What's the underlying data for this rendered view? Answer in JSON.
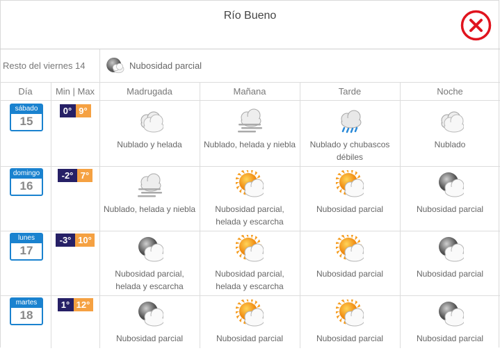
{
  "window": {
    "title": "Río Bueno",
    "close_icon": "close-circle-icon",
    "close_color": "#e0141e"
  },
  "rest_of_day": {
    "label": "Resto del viernes 14",
    "condition": "Nubosidad parcial",
    "icon": "partly-cloudy-night-icon"
  },
  "table": {
    "headers": {
      "day": "Día",
      "minmax": "Min | Max",
      "periods": [
        "Madrugada",
        "Mañana",
        "Tarde",
        "Noche"
      ]
    },
    "days": [
      {
        "weekday": "sábado",
        "date": "15",
        "min": "0°",
        "max": "9°",
        "periods": [
          {
            "icon": "cloudy-frost-icon",
            "text": "Nublado y helada"
          },
          {
            "icon": "cloudy-frost-fog-icon",
            "text": "Nublado, helada y niebla"
          },
          {
            "icon": "cloudy-showers-icon",
            "text": "Nublado y chubascos débiles"
          },
          {
            "icon": "cloudy-icon",
            "text": "Nublado"
          }
        ]
      },
      {
        "weekday": "domingo",
        "date": "16",
        "min": "-2°",
        "max": "7°",
        "periods": [
          {
            "icon": "cloudy-frost-fog-icon",
            "text": "Nublado, helada y niebla"
          },
          {
            "icon": "partly-cloudy-sun-icon",
            "text": "Nubosidad parcial, helada y escarcha"
          },
          {
            "icon": "partly-cloudy-sun-icon",
            "text": "Nubosidad parcial"
          },
          {
            "icon": "partly-cloudy-night-icon",
            "text": "Nubosidad parcial"
          }
        ]
      },
      {
        "weekday": "lunes",
        "date": "17",
        "min": "-3°",
        "max": "10°",
        "periods": [
          {
            "icon": "partly-cloudy-night-icon",
            "text": "Nubosidad parcial, helada y escarcha"
          },
          {
            "icon": "partly-cloudy-sun-icon",
            "text": "Nubosidad parcial, helada y escarcha"
          },
          {
            "icon": "partly-cloudy-sun-icon",
            "text": "Nubosidad parcial"
          },
          {
            "icon": "partly-cloudy-night-icon",
            "text": "Nubosidad parcial"
          }
        ]
      },
      {
        "weekday": "martes",
        "date": "18",
        "min": "1°",
        "max": "12°",
        "periods": [
          {
            "icon": "partly-cloudy-night-icon",
            "text": "Nubosidad parcial"
          },
          {
            "icon": "partly-cloudy-sun-icon",
            "text": "Nubosidad parcial"
          },
          {
            "icon": "partly-cloudy-sun-icon",
            "text": "Nubosidad parcial"
          },
          {
            "icon": "partly-cloudy-night-icon",
            "text": "Nubosidad parcial"
          }
        ]
      }
    ]
  },
  "colors": {
    "calendar_blue": "#1a82cf",
    "min_temp_bg": "#262066",
    "max_temp_bg": "#f5a142",
    "sun_orange": "#f59b1c"
  }
}
